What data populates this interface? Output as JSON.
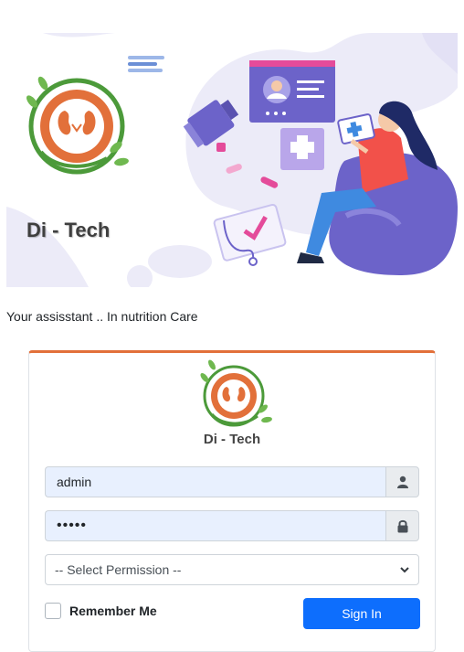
{
  "hero": {
    "brand": "Di - Tech"
  },
  "tagline": "Your assisstant .. In nutrition Care",
  "login": {
    "brand": "Di - Tech",
    "username_value": "admin",
    "password_value": "•••••",
    "permission_selected": "-- Select Permission --",
    "remember_label": "Remember Me",
    "signin_label": "Sign In"
  },
  "icons": {
    "username": "user-icon",
    "password": "lock-icon",
    "select": "chevron-down-icon"
  },
  "colors": {
    "accent_orange": "#e2703a",
    "primary_button": "#0d6efd",
    "input_autofill": "#e8f0fe",
    "illustration_purple": "#6c63c9",
    "logo_green": "#4c9a3a"
  }
}
